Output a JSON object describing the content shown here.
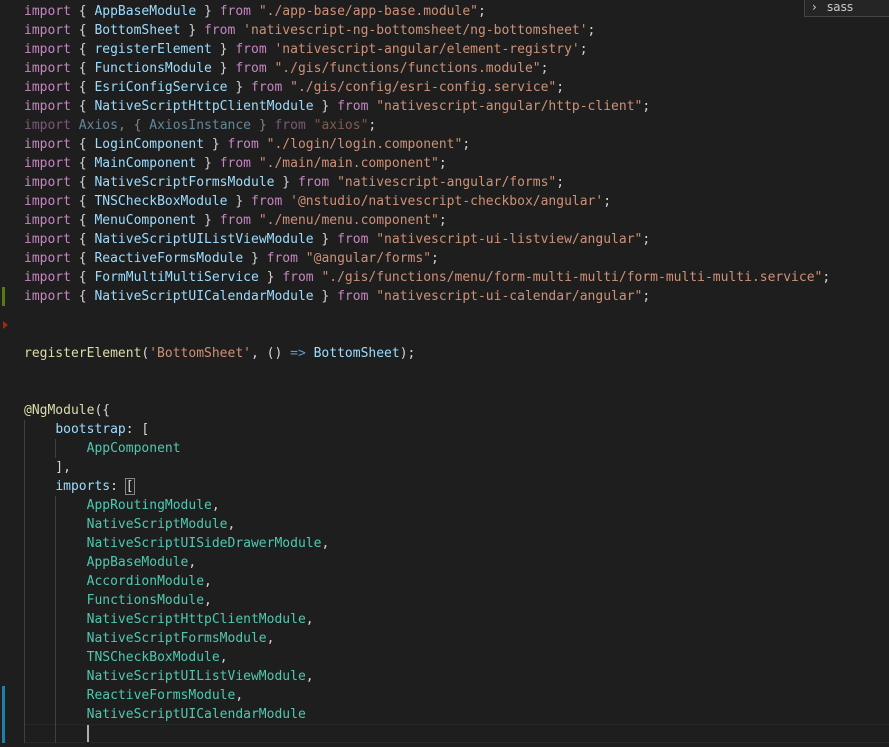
{
  "editor": {
    "lines": [
      [
        [
          "kw",
          "import"
        ],
        [
          "pun",
          " { "
        ],
        [
          "id",
          "AppBaseModule"
        ],
        [
          "pun",
          " } "
        ],
        [
          "kw",
          "from"
        ],
        [
          "pun",
          " "
        ],
        [
          "str",
          "\"./app-base/app-base.module\""
        ],
        [
          "pun",
          ";"
        ]
      ],
      [
        [
          "kw",
          "import"
        ],
        [
          "pun",
          " { "
        ],
        [
          "id",
          "BottomSheet"
        ],
        [
          "pun",
          " } "
        ],
        [
          "kw",
          "from"
        ],
        [
          "pun",
          " "
        ],
        [
          "str",
          "'nativescript-ng-bottomsheet/ng-bottomsheet'"
        ],
        [
          "pun",
          ";"
        ]
      ],
      [
        [
          "kw",
          "import"
        ],
        [
          "pun",
          " { "
        ],
        [
          "id",
          "registerElement"
        ],
        [
          "pun",
          " } "
        ],
        [
          "kw",
          "from"
        ],
        [
          "pun",
          " "
        ],
        [
          "str",
          "'nativescript-angular/element-registry'"
        ],
        [
          "pun",
          ";"
        ]
      ],
      [
        [
          "kw",
          "import"
        ],
        [
          "pun",
          " { "
        ],
        [
          "id",
          "FunctionsModule"
        ],
        [
          "pun",
          " } "
        ],
        [
          "kw",
          "from"
        ],
        [
          "pun",
          " "
        ],
        [
          "str",
          "\"./gis/functions/functions.module\""
        ],
        [
          "pun",
          ";"
        ]
      ],
      [
        [
          "kw",
          "import"
        ],
        [
          "pun",
          " { "
        ],
        [
          "id",
          "EsriConfigService"
        ],
        [
          "pun",
          " } "
        ],
        [
          "kw",
          "from"
        ],
        [
          "pun",
          " "
        ],
        [
          "str",
          "\"./gis/config/esri-config.service\""
        ],
        [
          "pun",
          ";"
        ]
      ],
      [
        [
          "kw",
          "import"
        ],
        [
          "pun",
          " { "
        ],
        [
          "id",
          "NativeScriptHttpClientModule"
        ],
        [
          "pun",
          " } "
        ],
        [
          "kw",
          "from"
        ],
        [
          "pun",
          " "
        ],
        [
          "str",
          "\"nativescript-angular/http-client\""
        ],
        [
          "pun",
          ";"
        ]
      ],
      [
        [
          "kw dim",
          "import"
        ],
        [
          "pun dim",
          " "
        ],
        [
          "id dim",
          "Axios"
        ],
        [
          "pun dim",
          ", { "
        ],
        [
          "id dim",
          "AxiosInstance"
        ],
        [
          "pun dim",
          " } "
        ],
        [
          "kw dim",
          "from"
        ],
        [
          "pun dim",
          " "
        ],
        [
          "str dim",
          "\"axios\""
        ],
        [
          "pun",
          ";"
        ]
      ],
      [
        [
          "kw",
          "import"
        ],
        [
          "pun",
          " { "
        ],
        [
          "id",
          "LoginComponent"
        ],
        [
          "pun",
          " } "
        ],
        [
          "kw",
          "from"
        ],
        [
          "pun",
          " "
        ],
        [
          "str",
          "\"./login/login.component\""
        ],
        [
          "pun",
          ";"
        ]
      ],
      [
        [
          "kw",
          "import"
        ],
        [
          "pun",
          " { "
        ],
        [
          "id",
          "MainComponent"
        ],
        [
          "pun",
          " } "
        ],
        [
          "kw",
          "from"
        ],
        [
          "pun",
          " "
        ],
        [
          "str",
          "\"./main/main.component\""
        ],
        [
          "pun",
          ";"
        ]
      ],
      [
        [
          "kw",
          "import"
        ],
        [
          "pun",
          " { "
        ],
        [
          "id",
          "NativeScriptFormsModule"
        ],
        [
          "pun",
          " } "
        ],
        [
          "kw",
          "from"
        ],
        [
          "pun",
          " "
        ],
        [
          "str",
          "\"nativescript-angular/forms\""
        ],
        [
          "pun",
          ";"
        ]
      ],
      [
        [
          "kw",
          "import"
        ],
        [
          "pun",
          " { "
        ],
        [
          "id",
          "TNSCheckBoxModule"
        ],
        [
          "pun",
          " } "
        ],
        [
          "kw",
          "from"
        ],
        [
          "pun",
          " "
        ],
        [
          "str",
          "'@nstudio/nativescript-checkbox/angular'"
        ],
        [
          "pun",
          ";"
        ]
      ],
      [
        [
          "kw",
          "import"
        ],
        [
          "pun",
          " { "
        ],
        [
          "id",
          "MenuComponent"
        ],
        [
          "pun",
          " } "
        ],
        [
          "kw",
          "from"
        ],
        [
          "pun",
          " "
        ],
        [
          "str",
          "\"./menu/menu.component\""
        ],
        [
          "pun",
          ";"
        ]
      ],
      [
        [
          "kw",
          "import"
        ],
        [
          "pun",
          " { "
        ],
        [
          "id",
          "NativeScriptUIListViewModule"
        ],
        [
          "pun",
          " } "
        ],
        [
          "kw",
          "from"
        ],
        [
          "pun",
          " "
        ],
        [
          "str",
          "\"nativescript-ui-listview/angular\""
        ],
        [
          "pun",
          ";"
        ]
      ],
      [
        [
          "kw",
          "import"
        ],
        [
          "pun",
          " { "
        ],
        [
          "id",
          "ReactiveFormsModule"
        ],
        [
          "pun",
          " } "
        ],
        [
          "kw",
          "from"
        ],
        [
          "pun",
          " "
        ],
        [
          "str",
          "\"@angular/forms\""
        ],
        [
          "pun",
          ";"
        ]
      ],
      [
        [
          "kw",
          "import"
        ],
        [
          "pun",
          " { "
        ],
        [
          "id",
          "FormMultiMultiService"
        ],
        [
          "pun",
          " } "
        ],
        [
          "kw",
          "from"
        ],
        [
          "pun",
          " "
        ],
        [
          "str",
          "\"./gis/functions/menu/form-multi-multi/form-multi-multi.service\""
        ],
        [
          "pun",
          ";"
        ]
      ],
      [
        [
          "kw",
          "import"
        ],
        [
          "pun",
          " { "
        ],
        [
          "id",
          "NativeScriptUICalendarModule"
        ],
        [
          "pun",
          " } "
        ],
        [
          "kw",
          "from"
        ],
        [
          "pun",
          " "
        ],
        [
          "str",
          "\"nativescript-ui-calendar/angular\""
        ],
        [
          "pun",
          ";"
        ]
      ],
      [],
      [],
      [
        [
          "fn",
          "registerElement"
        ],
        [
          "pun",
          "("
        ],
        [
          "str",
          "'BottomSheet'"
        ],
        [
          "pun",
          ", () "
        ],
        [
          "stor",
          "=>"
        ],
        [
          "pun",
          " "
        ],
        [
          "id",
          "BottomSheet"
        ],
        [
          "pun",
          ");"
        ]
      ],
      [],
      [],
      [
        [
          "fn",
          "@NgModule"
        ],
        [
          "pun",
          "({"
        ]
      ],
      [
        [
          "pun",
          "    "
        ],
        [
          "id",
          "bootstrap"
        ],
        [
          "pun",
          ": ["
        ]
      ],
      [
        [
          "pun",
          "        "
        ],
        [
          "cls",
          "AppComponent"
        ]
      ],
      [
        [
          "pun",
          "    ],"
        ]
      ],
      [
        [
          "pun",
          "    "
        ],
        [
          "id",
          "imports"
        ],
        [
          "pun",
          ": "
        ],
        [
          "pun bracket-hl",
          "["
        ]
      ],
      [
        [
          "pun",
          "        "
        ],
        [
          "cls",
          "AppRoutingModule"
        ],
        [
          "pun",
          ","
        ]
      ],
      [
        [
          "pun",
          "        "
        ],
        [
          "cls",
          "NativeScriptModule"
        ],
        [
          "pun",
          ","
        ]
      ],
      [
        [
          "pun",
          "        "
        ],
        [
          "cls",
          "NativeScriptUISideDrawerModule"
        ],
        [
          "pun",
          ","
        ]
      ],
      [
        [
          "pun",
          "        "
        ],
        [
          "cls",
          "AppBaseModule"
        ],
        [
          "pun",
          ","
        ]
      ],
      [
        [
          "pun",
          "        "
        ],
        [
          "cls",
          "AccordionModule"
        ],
        [
          "pun",
          ","
        ]
      ],
      [
        [
          "pun",
          "        "
        ],
        [
          "cls",
          "FunctionsModule"
        ],
        [
          "pun",
          ","
        ]
      ],
      [
        [
          "pun",
          "        "
        ],
        [
          "cls",
          "NativeScriptHttpClientModule"
        ],
        [
          "pun",
          ","
        ]
      ],
      [
        [
          "pun",
          "        "
        ],
        [
          "cls",
          "NativeScriptFormsModule"
        ],
        [
          "pun",
          ","
        ]
      ],
      [
        [
          "pun",
          "        "
        ],
        [
          "cls",
          "TNSCheckBoxModule"
        ],
        [
          "pun",
          ","
        ]
      ],
      [
        [
          "pun",
          "        "
        ],
        [
          "cls",
          "NativeScriptUIListViewModule"
        ],
        [
          "pun",
          ","
        ]
      ],
      [
        [
          "pun",
          "        "
        ],
        [
          "cls",
          "ReactiveFormsModule"
        ],
        [
          "pun",
          ","
        ]
      ],
      [
        [
          "pun",
          "        "
        ],
        [
          "cls",
          "NativeScriptUICalendarModule"
        ]
      ],
      [
        [
          "pun",
          "        "
        ]
      ]
    ],
    "guides": [
      {
        "from": 22,
        "to": 38,
        "col": 0
      },
      {
        "from": 23,
        "to": 23,
        "col": 4
      },
      {
        "from": 26,
        "to": 38,
        "col": 4
      }
    ],
    "gutter_marks": [
      {
        "type": "modified",
        "line": 15
      },
      {
        "type": "added",
        "line": 36,
        "to": 38
      }
    ],
    "gutter_arrows": [
      17
    ],
    "cursor_line": 38
  },
  "suggest": {
    "label": "sass",
    "icon": "chevron-right-icon",
    "chevron": "›"
  },
  "colors": {
    "background": "#1e1e1e",
    "keyword": "#c586c0",
    "identifier": "#9cdcfe",
    "class": "#4ec9b0",
    "string": "#ce9178",
    "function": "#dcdcaa"
  }
}
